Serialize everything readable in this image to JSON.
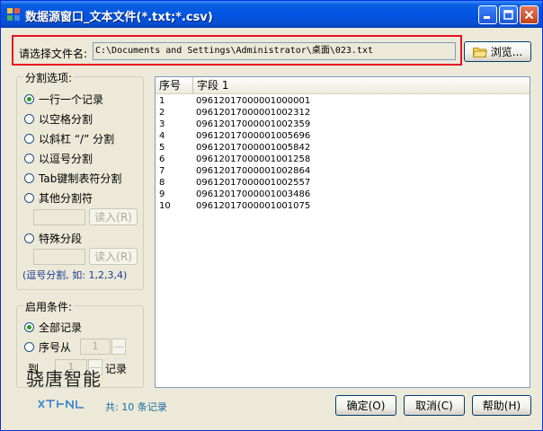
{
  "window": {
    "title": "数据源窗口_文本文件(*.txt;*.csv)"
  },
  "file": {
    "label": "请选择文件名:",
    "path": "C:\\Documents and Settings\\Administrator\\桌面\\023.txt",
    "browse_label": "浏览..."
  },
  "split_options": {
    "title": "分割选项:",
    "options": [
      {
        "label": "一行一个记录",
        "checked": true
      },
      {
        "label": "以空格分割",
        "checked": false
      },
      {
        "label": "以斜杠 “/” 分割",
        "checked": false
      },
      {
        "label": "以逗号分割",
        "checked": false
      },
      {
        "label": "Tab键制表符分割",
        "checked": false
      },
      {
        "label": "其他分割符",
        "checked": false
      },
      {
        "label": "特殊分段",
        "checked": false
      }
    ],
    "read_button_1": "读入(R)",
    "read_button_2": "读入(R)",
    "hint": "(逗号分割, 如: 1,2,3,4)"
  },
  "conditions": {
    "title": "启用条件:",
    "all_records": "全部记录",
    "from_seq": "序号从",
    "from_value": "1",
    "to": "到",
    "to_value": "1",
    "records_suffix": "记录"
  },
  "table": {
    "headers": [
      "序号",
      "字段 1"
    ],
    "rows": [
      [
        "1",
        "09612017000001000001"
      ],
      [
        "2",
        "09612017000001002312"
      ],
      [
        "3",
        "09612017000001002359"
      ],
      [
        "4",
        "09612017000001005696"
      ],
      [
        "5",
        "09612017000001005842"
      ],
      [
        "6",
        "09612017000001001258"
      ],
      [
        "7",
        "09612017000001002864"
      ],
      [
        "8",
        "09612017000001002557"
      ],
      [
        "9",
        "09612017000001003486"
      ],
      [
        "10",
        "09612017000001001075"
      ]
    ]
  },
  "footer": {
    "watermark": "骁唐智能",
    "total_text": "共: 10 条记录",
    "ok": "确定(O)",
    "cancel": "取消(C)",
    "help": "帮助(H)"
  },
  "colors": {
    "titlebar": "#0054e3",
    "highlight_border": "#e81123",
    "accent_text": "#1a6ba0"
  }
}
